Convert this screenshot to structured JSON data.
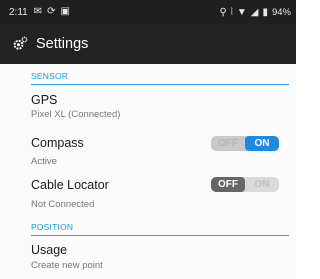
{
  "status_bar": {
    "time": "2:11",
    "left_icons": [
      "mail-icon",
      "sync-icon",
      "calendar-icon"
    ],
    "right_icons": [
      "location-icon",
      "vibrate-icon",
      "wifi-icon",
      "signal-icon"
    ],
    "battery": "94%"
  },
  "app_bar": {
    "title": "Settings",
    "icon": "gear-icon"
  },
  "sections": {
    "sensor": {
      "header": "SENSOR",
      "gps": {
        "title": "GPS",
        "subtitle": "Pixel XL (Connected)"
      },
      "compass": {
        "title": "Compass",
        "subtitle": "Active",
        "toggle_off": "OFF",
        "toggle_on": "ON",
        "state": "on"
      },
      "cable_locator": {
        "title": "Cable Locator",
        "subtitle": "Not Connected",
        "toggle_off": "OFF",
        "toggle_on": "ON",
        "state": "off"
      }
    },
    "position": {
      "header": "POSITION",
      "usage": {
        "title": "Usage",
        "subtitle": "Create new point"
      }
    }
  },
  "colors": {
    "accent": "#1E88E5",
    "section_header": "#1D9FD7",
    "app_bar": "#222222"
  }
}
